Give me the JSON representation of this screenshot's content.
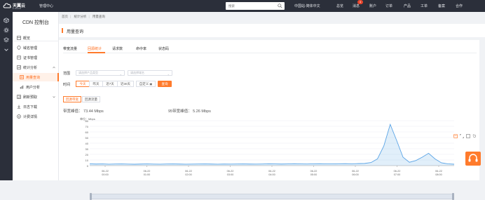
{
  "topbar": {
    "logo_text": "天翼云",
    "logo_sub": "e.Cloud",
    "management_center": "管理中心",
    "search_placeholder": "搜索",
    "region": "中国站-简体中文",
    "nav": [
      "总览",
      "消息",
      "账户",
      "订单",
      "产品",
      "工单",
      "备案",
      "合作"
    ],
    "message_count": "4"
  },
  "side": {
    "title": "CDN 控制台",
    "items": [
      {
        "label": "概览",
        "icon": "overview-icon"
      },
      {
        "label": "域名管理",
        "icon": "domain-icon"
      },
      {
        "label": "证书管理",
        "icon": "certificate-icon"
      },
      {
        "label": "统计分析",
        "icon": "statistics-icon",
        "expanded": true
      },
      {
        "label": "用量查询",
        "icon": "usage-icon",
        "active": true
      },
      {
        "label": "用户分析",
        "icon": "user-analysis-icon"
      },
      {
        "label": "刷新预取",
        "icon": "refresh-icon"
      },
      {
        "label": "日志下载",
        "icon": "log-download-icon"
      },
      {
        "label": "计费详情",
        "icon": "billing-icon"
      }
    ]
  },
  "breadcrumb": [
    "首页",
    "统计分析",
    "用量查询"
  ],
  "page_title": "用量查询",
  "tabs": [
    "带宽流量",
    "回源统计",
    "请求数",
    "命中率",
    "状态码"
  ],
  "active_tab": "回源统计",
  "filters": {
    "scope_label": "范围",
    "product_placeholder": "请选择产品类型",
    "domain_placeholder": "请选择域名",
    "time_label": "时间",
    "time_options": [
      "今天",
      "昨天",
      "近7天",
      "近30天",
      "自定义"
    ],
    "active_time": "今天",
    "query_button": "查询"
  },
  "type_buttons": [
    "回源带宽",
    "回源流量"
  ],
  "active_type": "回源带宽",
  "stats": {
    "peak_label": "带宽峰值：",
    "peak_value": "73.44 Mbps",
    "p95_label": "95带宽峰值：",
    "p95_value": "5.26 Mbps"
  },
  "colors": {
    "accent": "#ff7b2c",
    "topbar": "#2b2f3a",
    "line": "#5aa4e6"
  },
  "chart_data": {
    "type": "area",
    "unit_label": "单位：Mbps",
    "ylim": [
      0,
      80
    ],
    "yticks": [
      "0",
      "10",
      "20",
      "30",
      "40",
      "50",
      "60",
      "70",
      "80"
    ],
    "xticks": [
      [
        "06-22",
        "00:00"
      ],
      [
        "06-22",
        "01:00"
      ],
      [
        "06-22",
        "02:00"
      ],
      [
        "06-22",
        "03:00"
      ],
      [
        "06-22",
        "04:00"
      ],
      [
        "06-22",
        "05:00"
      ],
      [
        "06-22",
        "06:00"
      ],
      [
        "06-22",
        "07:00"
      ],
      [
        "06-22",
        "08:00"
      ]
    ],
    "grid": true,
    "series": [
      {
        "values": [
          3.2,
          2.8,
          3.0,
          2.6,
          2.9,
          3.1,
          2.7,
          2.5,
          2.8,
          3.0,
          2.7,
          2.6,
          2.9,
          3.0,
          2.8,
          2.6,
          2.7,
          2.9,
          3.1,
          2.8,
          2.6,
          2.8,
          2.7,
          2.9,
          3.0,
          2.8,
          2.7,
          2.9,
          3.2,
          3.0,
          2.8,
          3.1,
          3.3,
          3.0,
          2.9,
          3.2,
          3.4,
          3.1,
          3.0,
          3.3,
          3.5,
          3.2,
          3.6,
          3.9,
          5.5,
          12,
          35,
          73.44,
          45,
          15,
          6,
          9,
          15,
          22,
          12,
          5,
          3.2,
          2.5
        ]
      }
    ]
  }
}
